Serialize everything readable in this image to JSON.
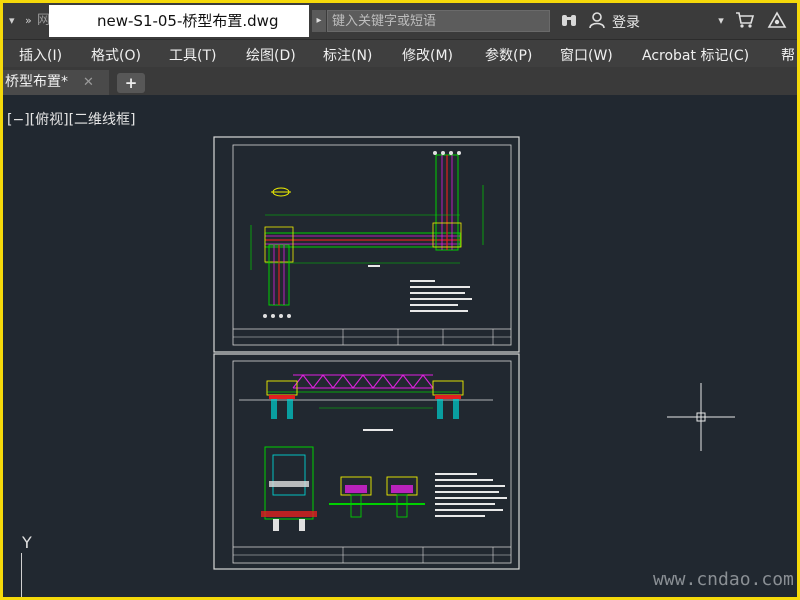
{
  "titlebar": {
    "quick_access_label": "网",
    "document_title": "new-S1-05-桥型布置.dwg",
    "search_placeholder": "键入关键字或短语",
    "login_label": "登录"
  },
  "menu": {
    "items": [
      "插入(I)",
      "格式(O)",
      "工具(T)",
      "绘图(D)",
      "标注(N)",
      "修改(M)",
      "参数(P)",
      "窗口(W)",
      "Acrobat 标记(C)",
      "帮"
    ]
  },
  "tabs": {
    "file_tab_label": "桥型布置*",
    "close_glyph": "✕",
    "new_tab_glyph": "+"
  },
  "viewport": {
    "label": "[−][俯视][二维线框]"
  },
  "ucs": {
    "axis_label": "Y"
  },
  "watermark": "www.cndao.com",
  "icons": [
    "dropdown-arrow-icon",
    "fast-forward-icon",
    "binoculars-icon",
    "user-icon",
    "chevron-down-icon",
    "cart-icon",
    "exchange-icon"
  ],
  "colors": {
    "window_border": "#f5d90a",
    "canvas_background": "#212830",
    "truss_magenta": "#e020e0",
    "drawing_green": "#00d000",
    "drawing_yellow": "#f0f000",
    "drawing_red": "#e02020",
    "drawing_cyan": "#00d0d0"
  }
}
